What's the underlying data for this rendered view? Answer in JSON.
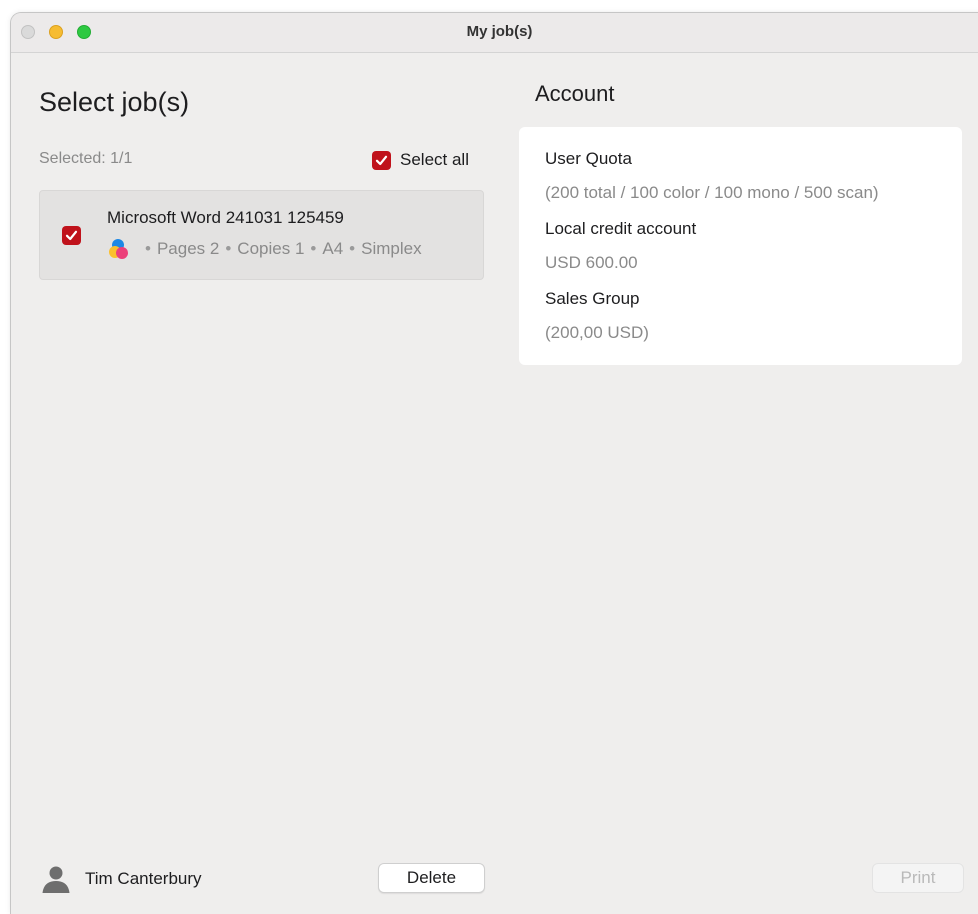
{
  "window": {
    "title": "My job(s)"
  },
  "jobs_panel": {
    "heading": "Select job(s)",
    "selected_count": "Selected: 1/1",
    "select_all_label": "Select all",
    "select_all_checked": true,
    "jobs": [
      {
        "title": "Microsoft Word 241031 125459",
        "checked": true,
        "icon": "color-print-icon",
        "pages": "Pages 2",
        "copies": "Copies 1",
        "paper": "A4",
        "sides": "Simplex"
      }
    ]
  },
  "account_panel": {
    "heading": "Account",
    "items": [
      {
        "label": "User Quota",
        "value": "(200 total / 100 color / 100 mono / 500 scan)"
      },
      {
        "label": "Local credit account",
        "value": "USD 600.00"
      },
      {
        "label": "Sales Group",
        "value": "(200,00 USD)"
      }
    ]
  },
  "footer": {
    "user_name": "Tim Canterbury",
    "user_icon": "person-icon",
    "delete_label": "Delete",
    "print_label": "Print",
    "print_enabled": false
  },
  "colors": {
    "accent_checkbox": "#c0121b",
    "window_bg": "#efeeed",
    "muted_text": "#8a8a8a"
  }
}
